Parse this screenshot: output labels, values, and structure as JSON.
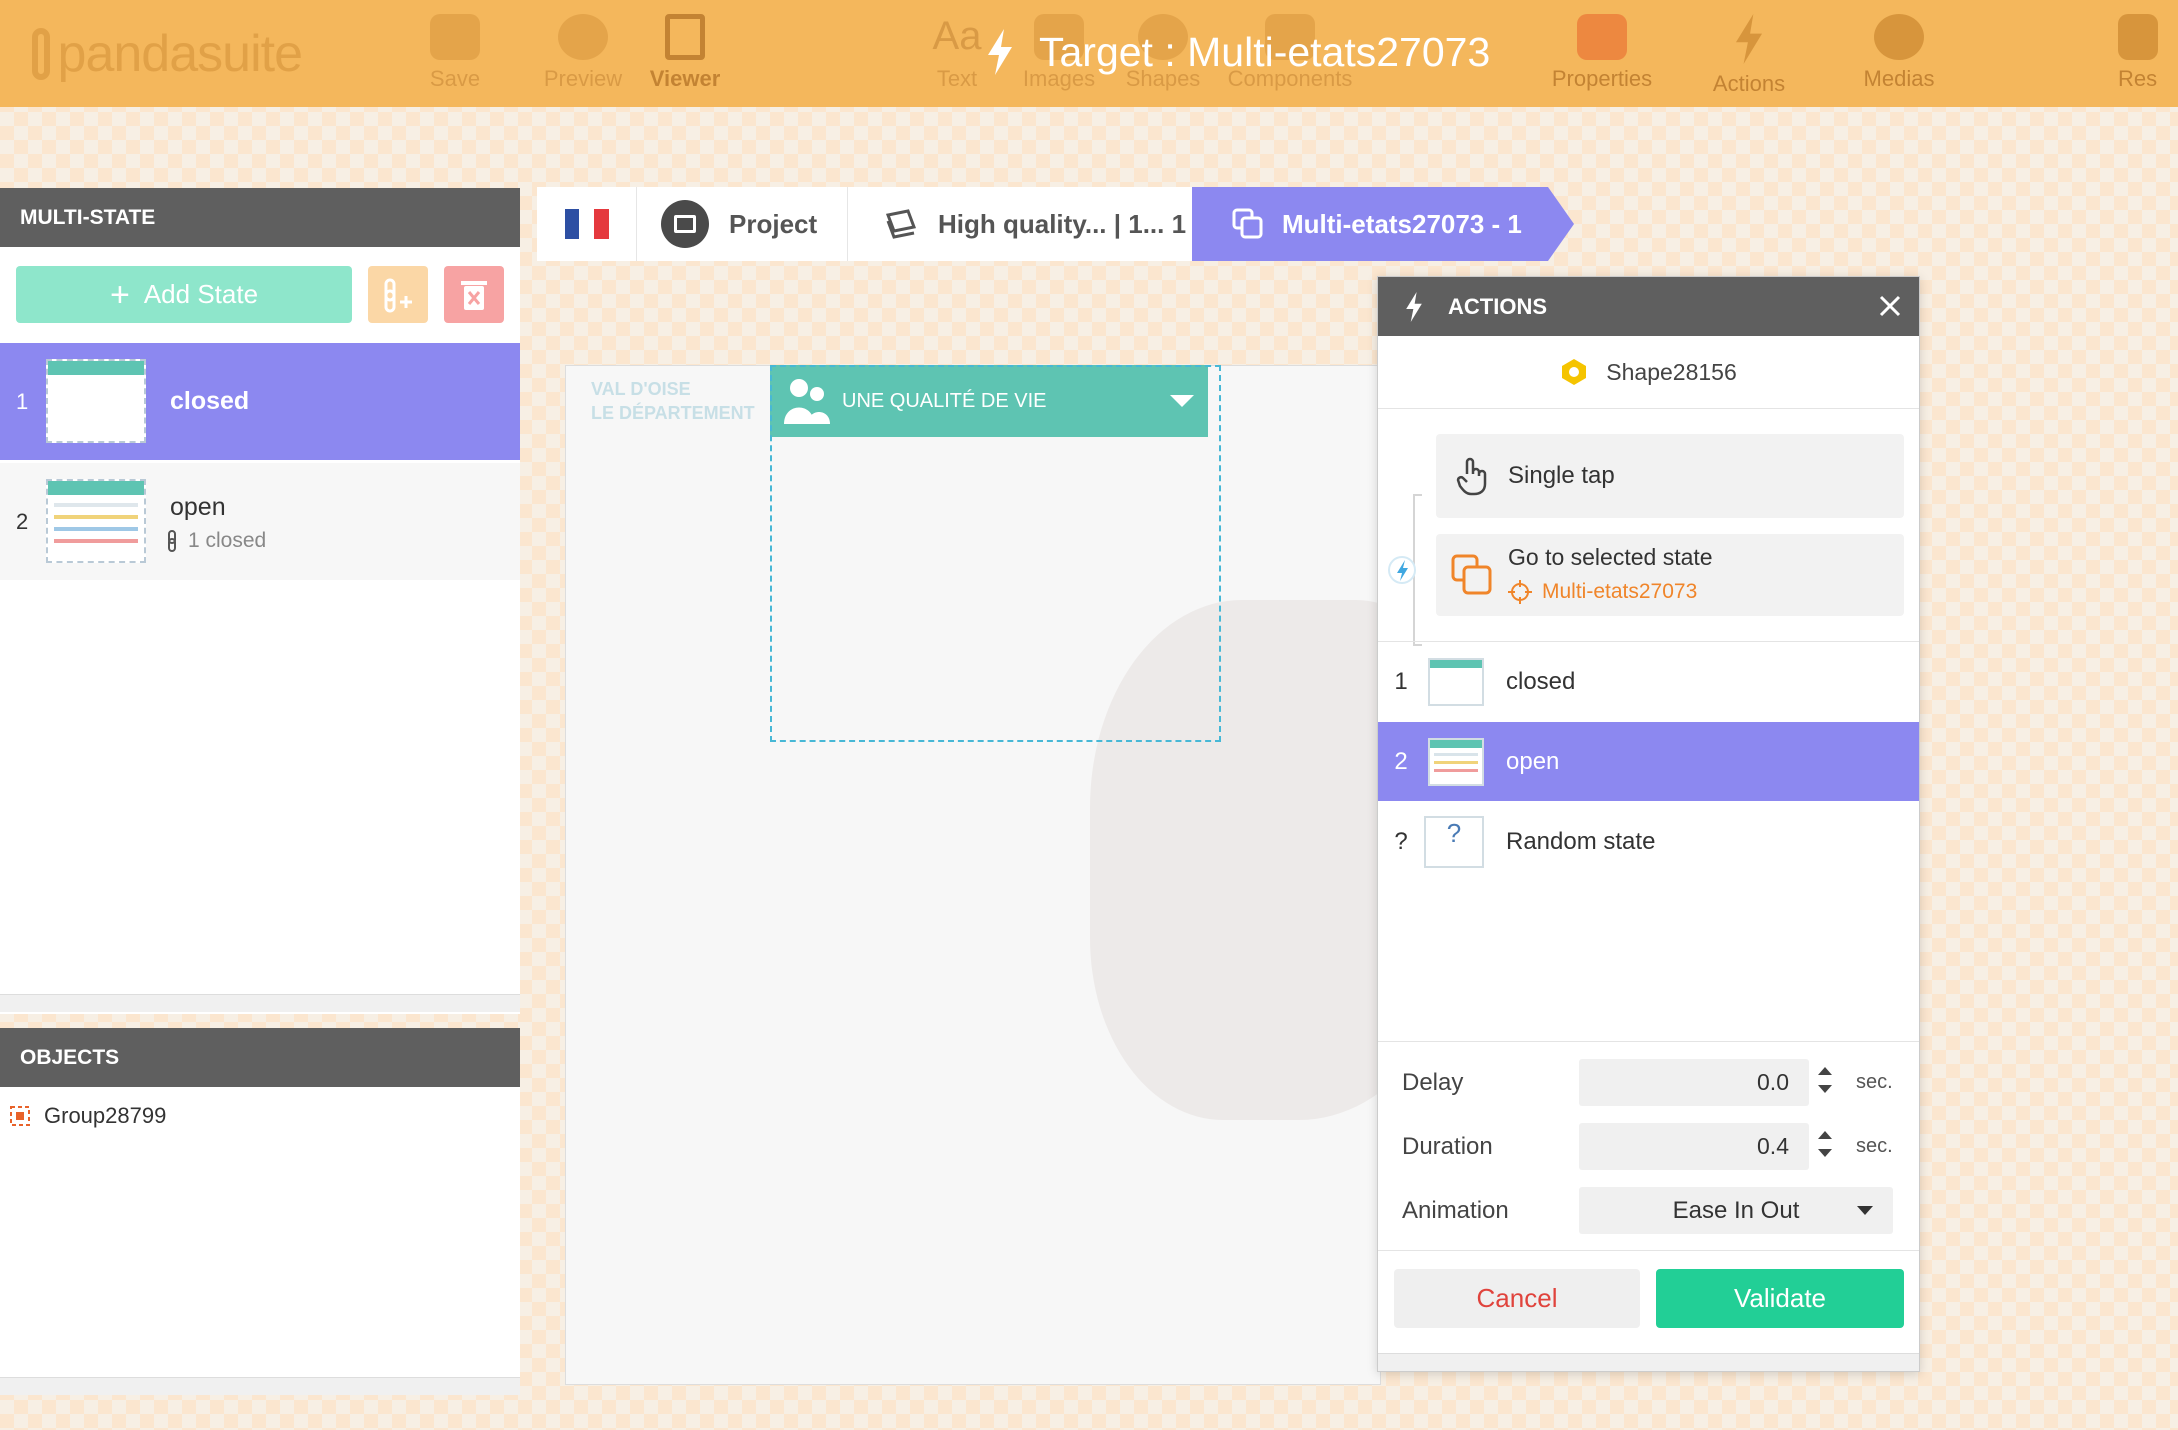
{
  "topbar": {
    "logo_text": "pandasuite",
    "tools_left": [
      {
        "label": "Save",
        "icon": "save-icon"
      },
      {
        "label": "Preview",
        "icon": "preview-icon"
      },
      {
        "label": "Viewer",
        "icon": "viewer-icon"
      }
    ],
    "tools_mid": [
      {
        "label": "Text",
        "icon": "text-icon"
      },
      {
        "label": "Images",
        "icon": "images-icon"
      },
      {
        "label": "Shapes",
        "icon": "shapes-icon"
      },
      {
        "label": "Components",
        "icon": "components-icon"
      }
    ],
    "tools_right": [
      {
        "label": "Properties",
        "icon": "properties-icon"
      },
      {
        "label": "Actions",
        "icon": "actions-icon"
      },
      {
        "label": "Medias",
        "icon": "medias-icon"
      },
      {
        "label": "Res",
        "icon": "resources-icon"
      }
    ],
    "title": "Target : Multi-etats27073",
    "accent_color": "#f4b75c"
  },
  "multistate": {
    "header": "MULTI-STATE",
    "add_state_label": "Add State",
    "states": [
      {
        "num": "1",
        "name": "closed",
        "selected": true
      },
      {
        "num": "2",
        "name": "open",
        "link_text": "1 closed",
        "selected": false
      }
    ],
    "selected_color": "#8c88f0"
  },
  "objects": {
    "header": "OBJECTS",
    "items": [
      {
        "name": "Group28799"
      }
    ]
  },
  "breadcrumb": {
    "project": "Project",
    "page": "High quality... | 1... 1",
    "current": "Multi-etats27073 - 1"
  },
  "canvas": {
    "brand_line1": "VAL D'OISE",
    "brand_line2": "LE DÉPARTEMENT",
    "dropdown_label": "UNE QUALITÉ DE VIE"
  },
  "actions_dialog": {
    "header": "ACTIONS",
    "target": "Shape28156",
    "trigger": "Single tap",
    "action": "Go to selected state",
    "action_target": "Multi-etats27073",
    "states": [
      {
        "num": "1",
        "name": "closed",
        "selected": false
      },
      {
        "num": "2",
        "name": "open",
        "selected": true
      },
      {
        "num": "?",
        "name": "Random state",
        "selected": false
      }
    ],
    "delay_label": "Delay",
    "delay_value": "0.0",
    "duration_label": "Duration",
    "duration_value": "0.4",
    "unit": "sec.",
    "animation_label": "Animation",
    "animation_value": "Ease In Out",
    "cancel_label": "Cancel",
    "validate_label": "Validate",
    "validate_color": "#22cf96",
    "cancel_color": "#e0433c"
  }
}
